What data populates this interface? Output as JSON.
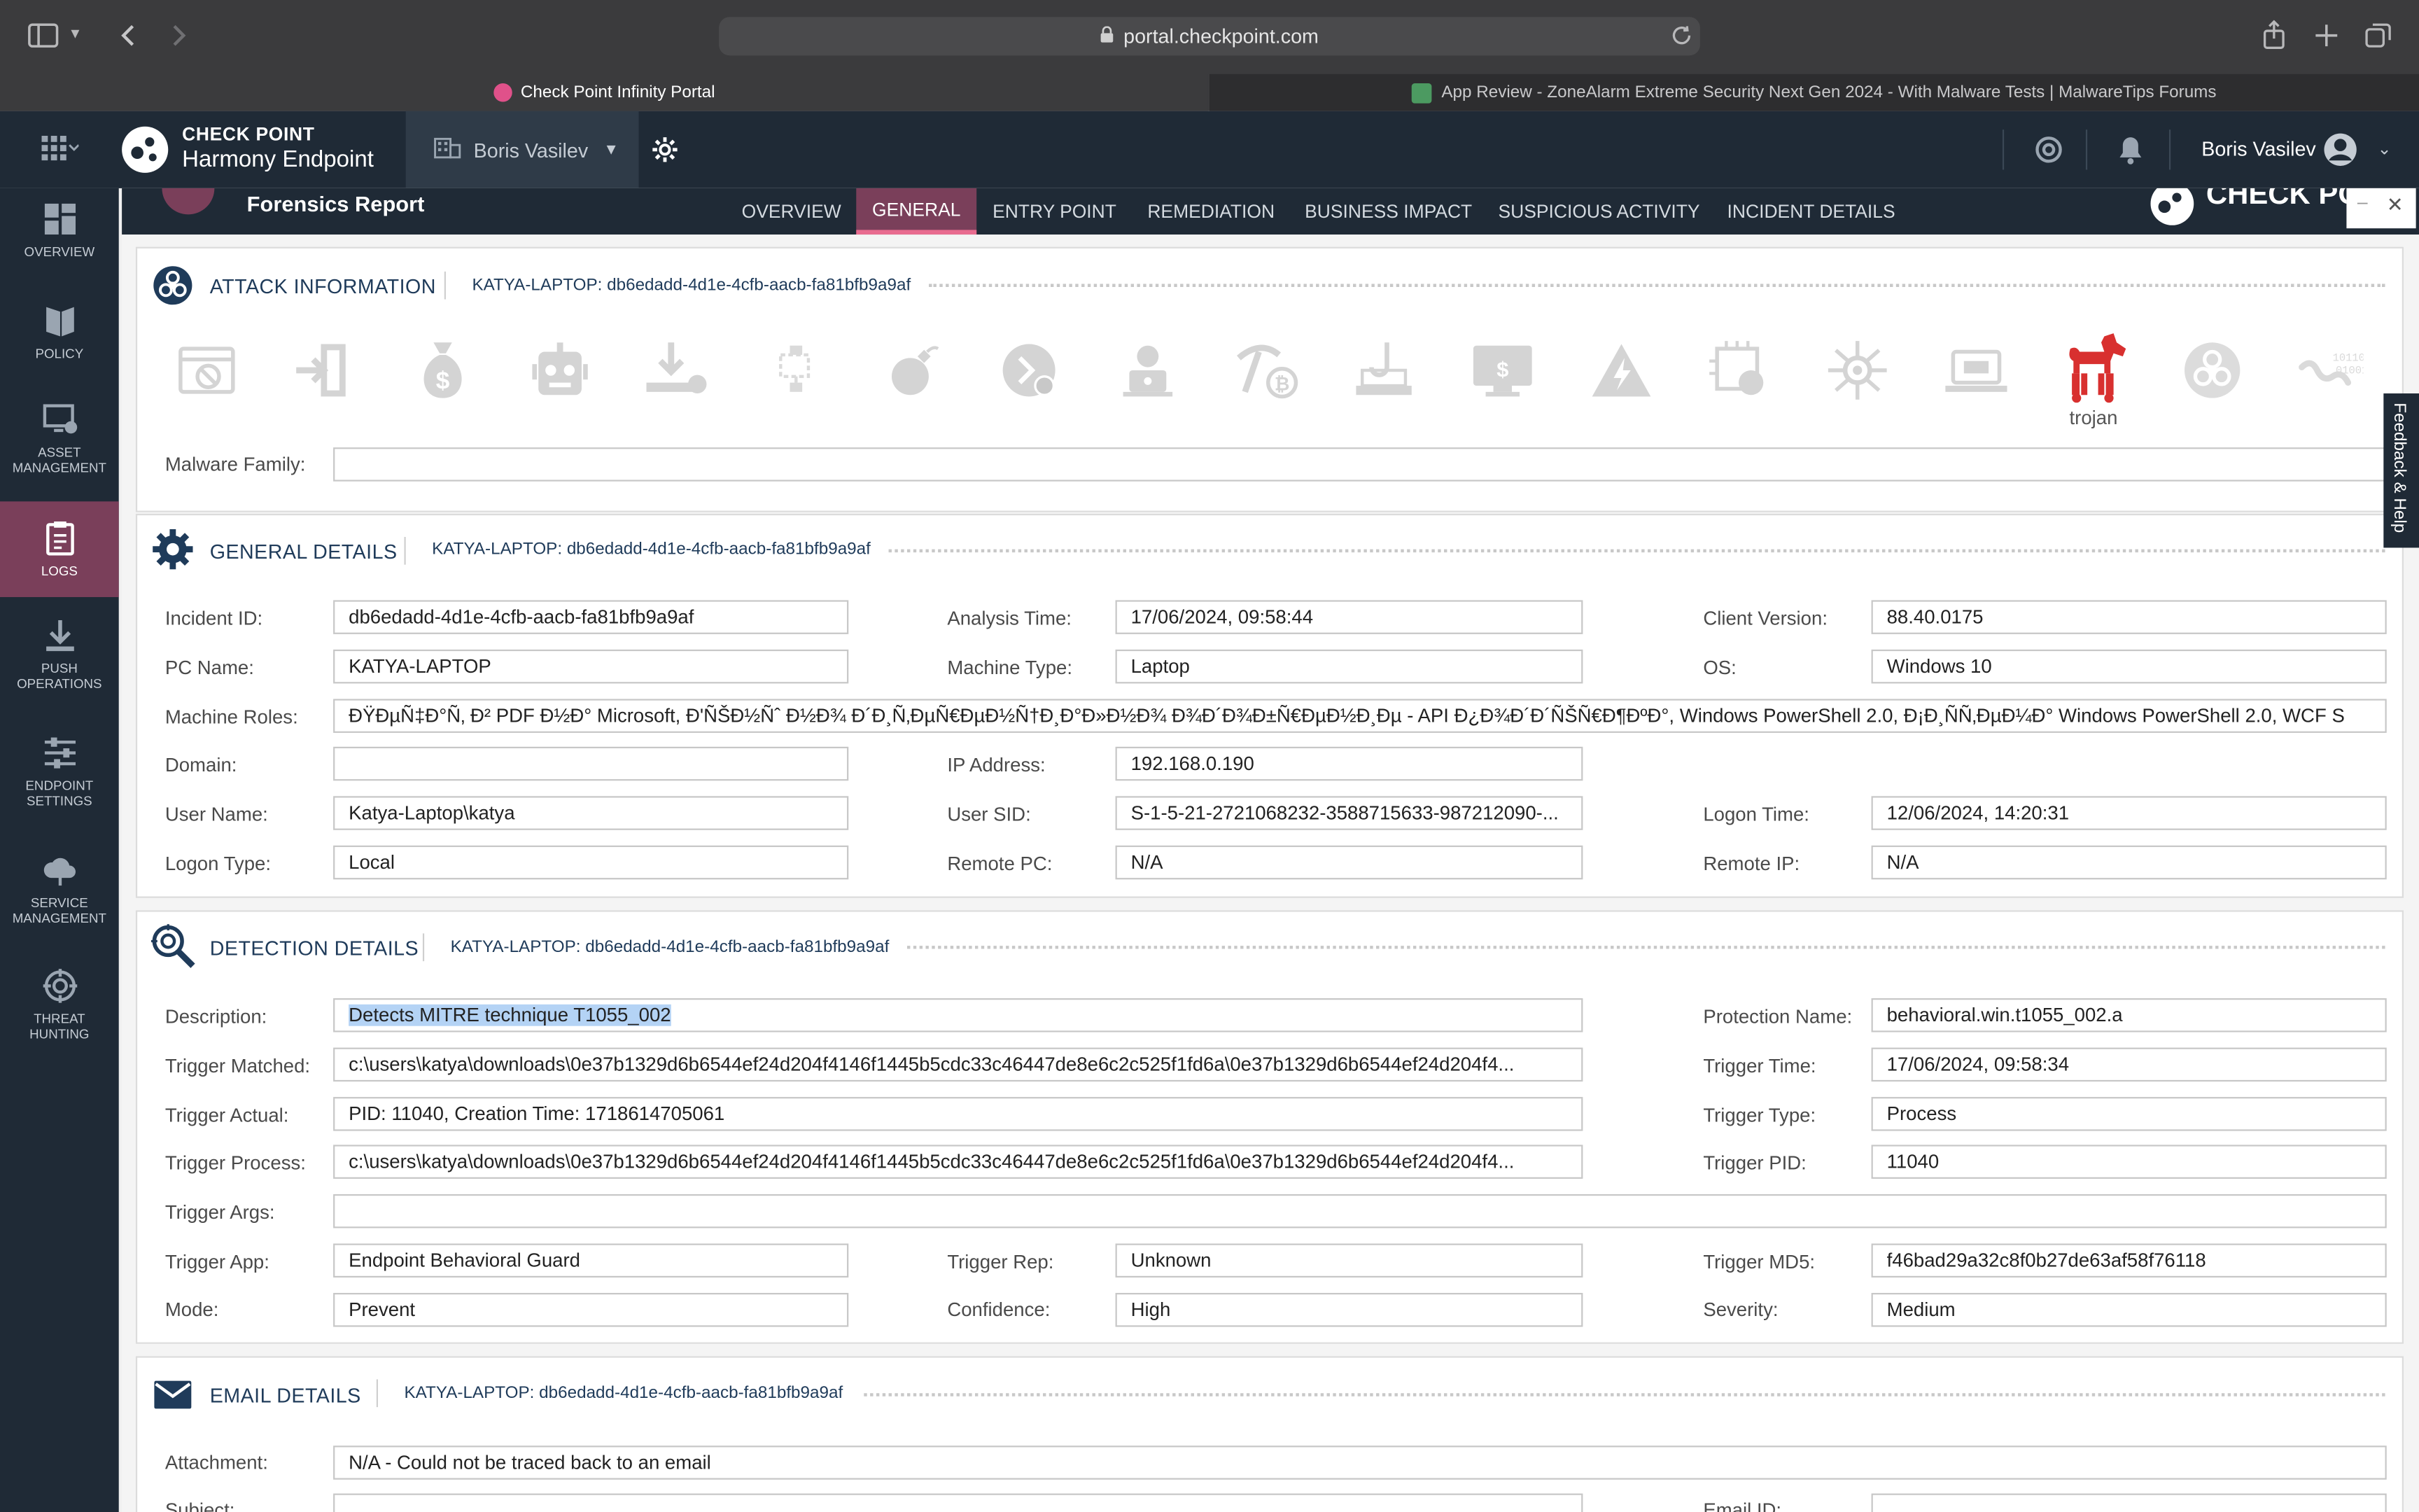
{
  "browser": {
    "url": "portal.checkpoint.com",
    "tabs": [
      {
        "label": "Check Point Infinity Portal"
      },
      {
        "label": "App Review - ZoneAlarm Extreme Security Next Gen 2024 - With Malware Tests | MalwareTips Forums"
      }
    ]
  },
  "app": {
    "brand_top": "CHECK POINT",
    "brand_bottom": "Harmony Endpoint",
    "tenant": "Boris Vasilev",
    "user": "Boris Vasilev"
  },
  "rail": [
    {
      "label": "OVERVIEW",
      "icon": "overview-icon"
    },
    {
      "label": "POLICY",
      "icon": "policy-icon"
    },
    {
      "label": "ASSET MANAGEMENT",
      "icon": "asset-icon"
    },
    {
      "label": "LOGS",
      "icon": "logs-icon",
      "active": true
    },
    {
      "label": "PUSH OPERATIONS",
      "icon": "push-icon"
    },
    {
      "label": "ENDPOINT SETTINGS",
      "icon": "settings-sliders-icon"
    },
    {
      "label": "SERVICE MANAGEMENT",
      "icon": "cloud-icon"
    },
    {
      "label": "THREAT HUNTING",
      "icon": "crosshair-icon"
    }
  ],
  "report": {
    "title": "Forensics Report",
    "logo_partial": "CHECK PO",
    "tabs": [
      "OVERVIEW",
      "GENERAL",
      "ENTRY POINT",
      "REMEDIATION",
      "BUSINESS IMPACT",
      "SUSPICIOUS ACTIVITY",
      "INCIDENT DETAILS"
    ],
    "active_tab": "GENERAL",
    "feedback": "Feedback & Help"
  },
  "attack": {
    "title": "ATTACK INFORMATION",
    "host": "KATYA-LAPTOP: db6edadd-4d1e-4cfb-aacb-fa81bfb9a9af",
    "active_icon_label": "trojan",
    "accent": "#d8302f",
    "malware_family_label": "Malware Family:",
    "malware_family_value": ""
  },
  "general": {
    "title": "GENERAL DETAILS",
    "host": "KATYA-LAPTOP: db6edadd-4d1e-4cfb-aacb-fa81bfb9a9af",
    "incident_id_label": "Incident ID:",
    "incident_id": "db6edadd-4d1e-4cfb-aacb-fa81bfb9a9af",
    "analysis_time_label": "Analysis Time:",
    "analysis_time": "17/06/2024, 09:58:44",
    "client_version_label": "Client Version:",
    "client_version": "88.40.0175",
    "pc_name_label": "PC Name:",
    "pc_name": "KATYA-LAPTOP",
    "machine_type_label": "Machine Type:",
    "machine_type": "Laptop",
    "os_label": "OS:",
    "os": "Windows 10",
    "machine_roles_label": "Machine Roles:",
    "machine_roles": "ÐŸÐµÑ‡Ð°Ñ‚ Ð² PDF Ð½Ð° Microsoft, Ð'ÑŠÐ½Ñˆ Ð½Ð¾ Ð´Ð¸Ñ‚ÐµÑ€ÐµÐ½Ñ†Ð¸Ð°Ð»Ð½Ð¾ Ð¾Ð´Ð¾Ð±Ñ€ÐµÐ½Ð¸Ðµ - API Ð¿Ð¾Ð´Ð´ÑŠÑ€Ð¶ÐºÐ°, Windows PowerShell 2.0, Ð¡Ð¸ÑÑ‚ÐµÐ¼Ð° Windows PowerShell 2.0, WCF S",
    "domain_label": "Domain:",
    "domain": "",
    "ip_label": "IP Address:",
    "ip": "192.168.0.190",
    "user_name_label": "User Name:",
    "user_name": "Katya-Laptop\\katya",
    "user_sid_label": "User SID:",
    "user_sid": "S-1-5-21-2721068232-3588715633-987212090-...",
    "logon_time_label": "Logon Time:",
    "logon_time": "12/06/2024, 14:20:31",
    "logon_type_label": "Logon Type:",
    "logon_type": "Local",
    "remote_pc_label": "Remote PC:",
    "remote_pc": "N/A",
    "remote_ip_label": "Remote IP:",
    "remote_ip": "N/A"
  },
  "detection": {
    "title": "DETECTION DETAILS",
    "host": "KATYA-LAPTOP: db6edadd-4d1e-4cfb-aacb-fa81bfb9a9af",
    "description_label": "Description:",
    "description": "Detects MITRE technique T1055_002",
    "protection_name_label": "Protection Name:",
    "protection_name": "behavioral.win.t1055_002.a",
    "trigger_matched_label": "Trigger Matched:",
    "trigger_matched": "c:\\users\\katya\\downloads\\0e37b1329d6b6544ef24d204f4146f1445b5cdc33c46447de8e6c2c525f1fd6a\\0e37b1329d6b6544ef24d204f4...",
    "trigger_time_label": "Trigger Time:",
    "trigger_time": "17/06/2024, 09:58:34",
    "trigger_actual_label": "Trigger Actual:",
    "trigger_actual": "PID: 11040, Creation Time: 1718614705061",
    "trigger_type_label": "Trigger Type:",
    "trigger_type": "Process",
    "trigger_process_label": "Trigger Process:",
    "trigger_process": "c:\\users\\katya\\downloads\\0e37b1329d6b6544ef24d204f4146f1445b5cdc33c46447de8e6c2c525f1fd6a\\0e37b1329d6b6544ef24d204f4...",
    "trigger_pid_label": "Trigger PID:",
    "trigger_pid": "11040",
    "trigger_args_label": "Trigger Args:",
    "trigger_args": "",
    "trigger_app_label": "Trigger App:",
    "trigger_app": "Endpoint Behavioral Guard",
    "trigger_rep_label": "Trigger Rep:",
    "trigger_rep": "Unknown",
    "trigger_md5_label": "Trigger MD5:",
    "trigger_md5": "f46bad29a32c8f0b27de63af58f76118",
    "mode_label": "Mode:",
    "mode": "Prevent",
    "confidence_label": "Confidence:",
    "confidence": "High",
    "severity_label": "Severity:",
    "severity": "Medium"
  },
  "email": {
    "title": "EMAIL DETAILS",
    "host": "KATYA-LAPTOP: db6edadd-4d1e-4cfb-aacb-fa81bfb9a9af",
    "attachment_label": "Attachment:",
    "attachment": "N/A - Could not be traced back to an email",
    "subject_label": "Subject:",
    "subject": "",
    "email_id_label": "Email ID:",
    "email_id": ""
  }
}
